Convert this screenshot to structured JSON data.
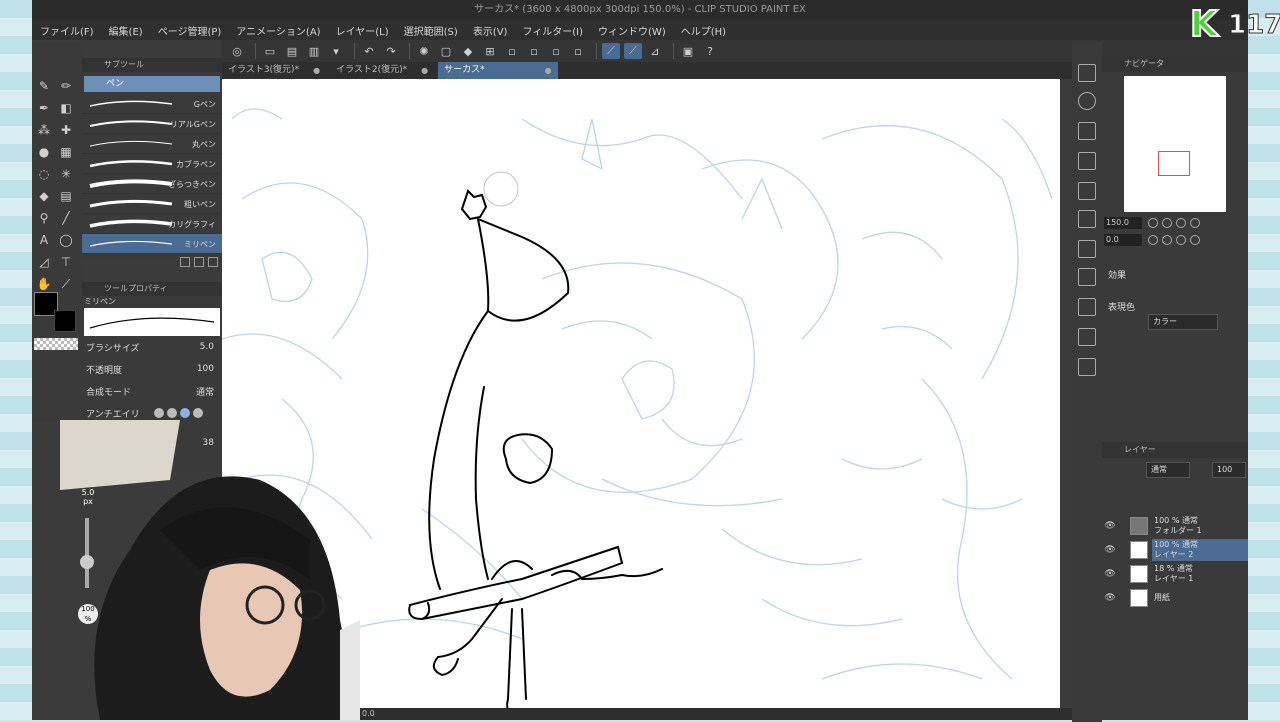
{
  "window": {
    "title": "サーカス* (3600 x 4800px 300dpi 150.0%)  - CLIP STUDIO PAINT EX"
  },
  "menu": [
    "ファイル(F)",
    "編集(E)",
    "ページ管理(P)",
    "アニメーション(A)",
    "レイヤー(L)",
    "選択範囲(S)",
    "表示(V)",
    "フィルター(I)",
    "ウィンドウ(W)",
    "ヘルプ(H)"
  ],
  "tabs": [
    {
      "label": "イラスト3(復元)*",
      "active": false
    },
    {
      "label": "イラスト2(復元)*",
      "active": false
    },
    {
      "label": "サーカス*",
      "active": true
    }
  ],
  "subtool": {
    "header": "サブツール",
    "category": "ペン",
    "brushes": [
      {
        "label": "Gペン",
        "active": false
      },
      {
        "label": "リアルGペン",
        "active": false
      },
      {
        "label": "丸ペン",
        "active": false
      },
      {
        "label": "カブラペン",
        "active": false
      },
      {
        "label": "ざらつきペン",
        "active": false
      },
      {
        "label": "粗いペン",
        "active": false
      },
      {
        "label": "カリグラフィ",
        "active": false
      },
      {
        "label": "ミリペン",
        "active": true
      }
    ]
  },
  "toolprop": {
    "header": "ツールプロパティ",
    "name": "ミリペン",
    "brush_size_label": "ブラシサイズ",
    "brush_size": "5.0",
    "opacity_label": "不透明度",
    "opacity": "100",
    "blend_label": "合成モード",
    "blend": "通常",
    "aa_label": "アンチエイリ",
    "extra_value": "38"
  },
  "navigator": {
    "header": "ナビゲータ",
    "zoom": "150.0",
    "rotate": "0.0"
  },
  "effects": {
    "header": "効果",
    "color_label": "表現色",
    "color_value": "カラー"
  },
  "layers": {
    "header": "レイヤー",
    "blend": "通常",
    "opacity": "100",
    "items": [
      {
        "line1": "100 % 通常",
        "line2": "フォルダー 1",
        "selected": false
      },
      {
        "line1": "100 % 通常",
        "line2": "レイヤー 2",
        "selected": true
      },
      {
        "line1": "18 % 通常",
        "line2": "レイヤー 1",
        "selected": false
      },
      {
        "line1": "用紙",
        "line2": "",
        "selected": false
      }
    ]
  },
  "overlay": {
    "brush_size": "5.0",
    "brush_unit": "px",
    "opacity": "100",
    "opacity_unit": "%"
  },
  "status": {
    "zoom": "0.0"
  },
  "badge": {
    "letter": "K",
    "number": "117",
    "color": "#4cd137"
  }
}
